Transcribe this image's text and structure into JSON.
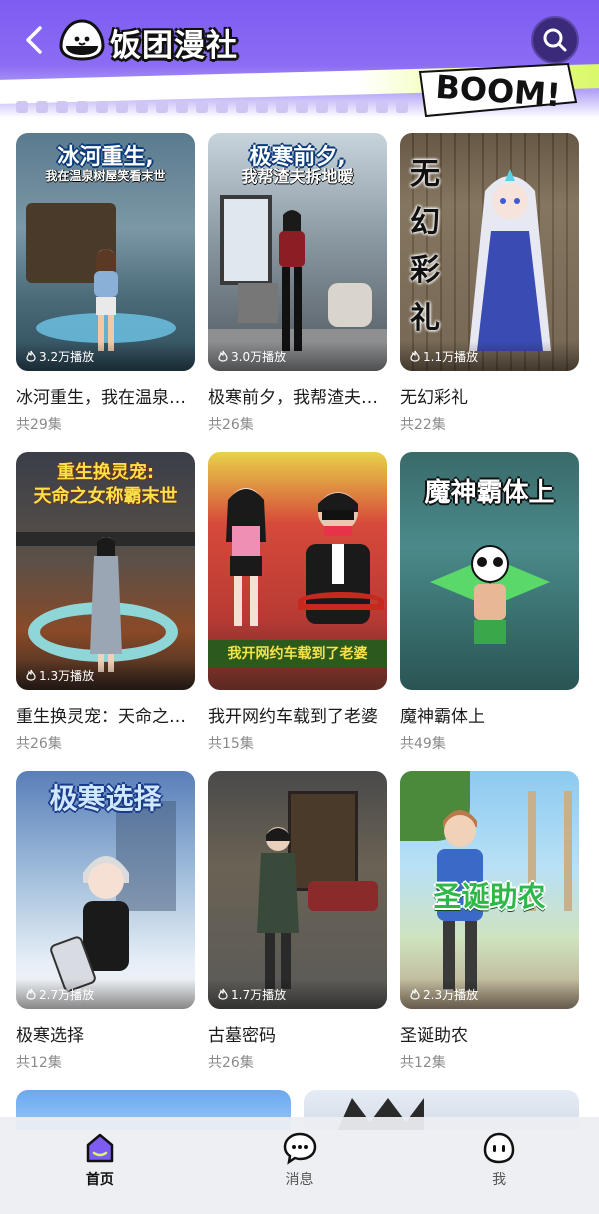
{
  "header": {
    "app_name": "饭团漫社",
    "badge_text": "BOOM!"
  },
  "colors": {
    "brand_purple": "#7d5cf2",
    "accent_lime": "#d9f86a",
    "search_bg": "#3b2a7a"
  },
  "cards": [
    {
      "cover_title": "冰河重生,",
      "cover_sub": "我在温泉树屋笑看末世",
      "plays": "3.2万播放",
      "title": "冰河重生，我在温泉树屋笑看末世",
      "episodes": "共29集",
      "style": "ice"
    },
    {
      "cover_title": "极寒前夕,",
      "cover_sub": "我帮渣夫拆地暖",
      "plays": "3.0万播放",
      "title": "极寒前夕，我帮渣夫拆地暖",
      "episodes": "共26集",
      "style": "room"
    },
    {
      "cover_vert": "无幻彩礼",
      "plays": "1.1万播放",
      "title": "无幻彩礼",
      "episodes": "共22集",
      "style": "goddess"
    },
    {
      "cover_title": "重生换灵宠:",
      "cover_sub": "天命之女称霸末世",
      "plays": "1.3万播放",
      "title": "重生换灵宠：天命之女称霸末世",
      "episodes": "共26集",
      "style": "snake"
    },
    {
      "cover_banner": "我开网约车载到了老婆",
      "title": "我开网约车载到了老婆",
      "episodes": "共15集",
      "style": "car"
    },
    {
      "cover_title": "魔神霸体上",
      "title": "魔神霸体上",
      "episodes": "共49集",
      "style": "panda"
    },
    {
      "cover_title": "极寒选择",
      "plays": "2.7万播放",
      "title": "极寒选择",
      "episodes": "共12集",
      "style": "snow"
    },
    {
      "plays": "1.7万播放",
      "title": "古墓密码",
      "episodes": "共26集",
      "style": "tomb"
    },
    {
      "cover_green": "圣诞助农",
      "plays": "2.3万播放",
      "title": "圣诞助农",
      "episodes": "共12集",
      "style": "farm"
    }
  ],
  "tabs": [
    {
      "label": "首页",
      "icon": "home-icon",
      "active": true
    },
    {
      "label": "消息",
      "icon": "message-icon",
      "active": false
    },
    {
      "label": "我",
      "icon": "profile-icon",
      "active": false
    }
  ]
}
